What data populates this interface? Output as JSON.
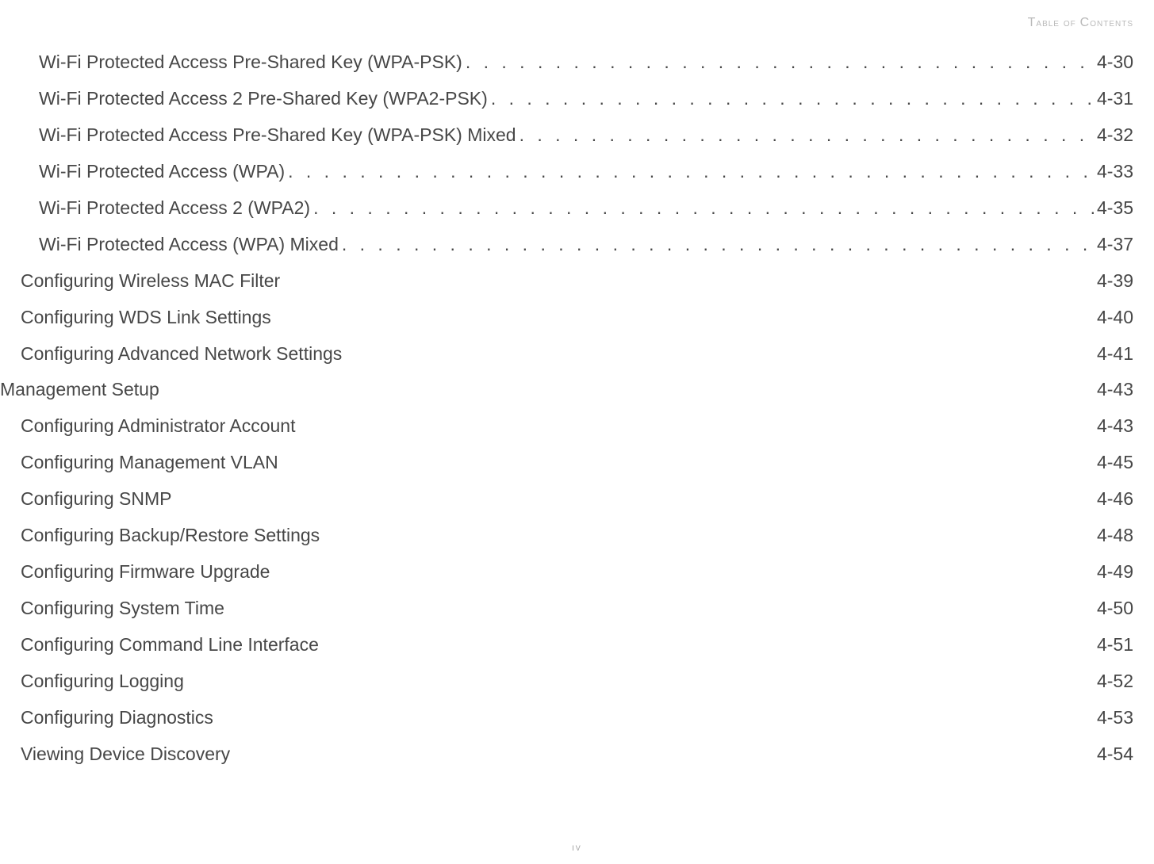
{
  "header": {
    "label": "Table of Contents"
  },
  "footer": {
    "page_label": "iv"
  },
  "toc": {
    "entries": [
      {
        "indent": 2,
        "label": "Wi-Fi Protected Access Pre-Shared Key (WPA-PSK)",
        "page": "4-30",
        "leader": "dots"
      },
      {
        "indent": 2,
        "label": "Wi-Fi Protected Access 2 Pre-Shared Key (WPA2-PSK)",
        "page": "4-31",
        "leader": "dots"
      },
      {
        "indent": 2,
        "label": "Wi-Fi Protected Access Pre-Shared Key (WPA-PSK) Mixed",
        "page": "4-32",
        "leader": "dots"
      },
      {
        "indent": 2,
        "label": "Wi-Fi Protected Access (WPA)",
        "page": "4-33",
        "leader": "dots"
      },
      {
        "indent": 2,
        "label": "Wi-Fi Protected Access 2 (WPA2)",
        "page": "4-35",
        "leader": "dots-spaced"
      },
      {
        "indent": 2,
        "label": "Wi-Fi Protected Access (WPA) Mixed",
        "page": "4-37",
        "leader": "dots"
      },
      {
        "indent": 1,
        "label": "Configuring Wireless MAC Filter",
        "page": "4-39",
        "leader": "none"
      },
      {
        "indent": 1,
        "label": "Configuring WDS Link Settings",
        "page": "4-40",
        "leader": "none"
      },
      {
        "indent": 1,
        "label": "Configuring Advanced Network Settings",
        "page": "4-41",
        "leader": "none"
      },
      {
        "indent": 0,
        "label": "Management Setup",
        "page": "4-43",
        "leader": "none"
      },
      {
        "indent": 1,
        "label": "Configuring Administrator Account",
        "page": "4-43",
        "leader": "none"
      },
      {
        "indent": 1,
        "label": "Configuring Management VLAN",
        "page": "4-45",
        "leader": "none"
      },
      {
        "indent": 1,
        "label": "Configuring SNMP",
        "page": "4-46",
        "leader": "none"
      },
      {
        "indent": 1,
        "label": "Configuring Backup/Restore Settings",
        "page": "4-48",
        "leader": "none"
      },
      {
        "indent": 1,
        "label": "Configuring Firmware Upgrade",
        "page": "4-49",
        "leader": "none"
      },
      {
        "indent": 1,
        "label": "Configuring System Time",
        "page": "4-50",
        "leader": "none"
      },
      {
        "indent": 1,
        "label": "Configuring Command Line Interface",
        "page": "4-51",
        "leader": "none"
      },
      {
        "indent": 1,
        "label": "Configuring Logging",
        "page": "4-52",
        "leader": "none"
      },
      {
        "indent": 1,
        "label": "Configuring Diagnostics",
        "page": "4-53",
        "leader": "none"
      },
      {
        "indent": 1,
        "label": "Viewing Device Discovery",
        "page": "4-54",
        "leader": "none"
      }
    ]
  }
}
